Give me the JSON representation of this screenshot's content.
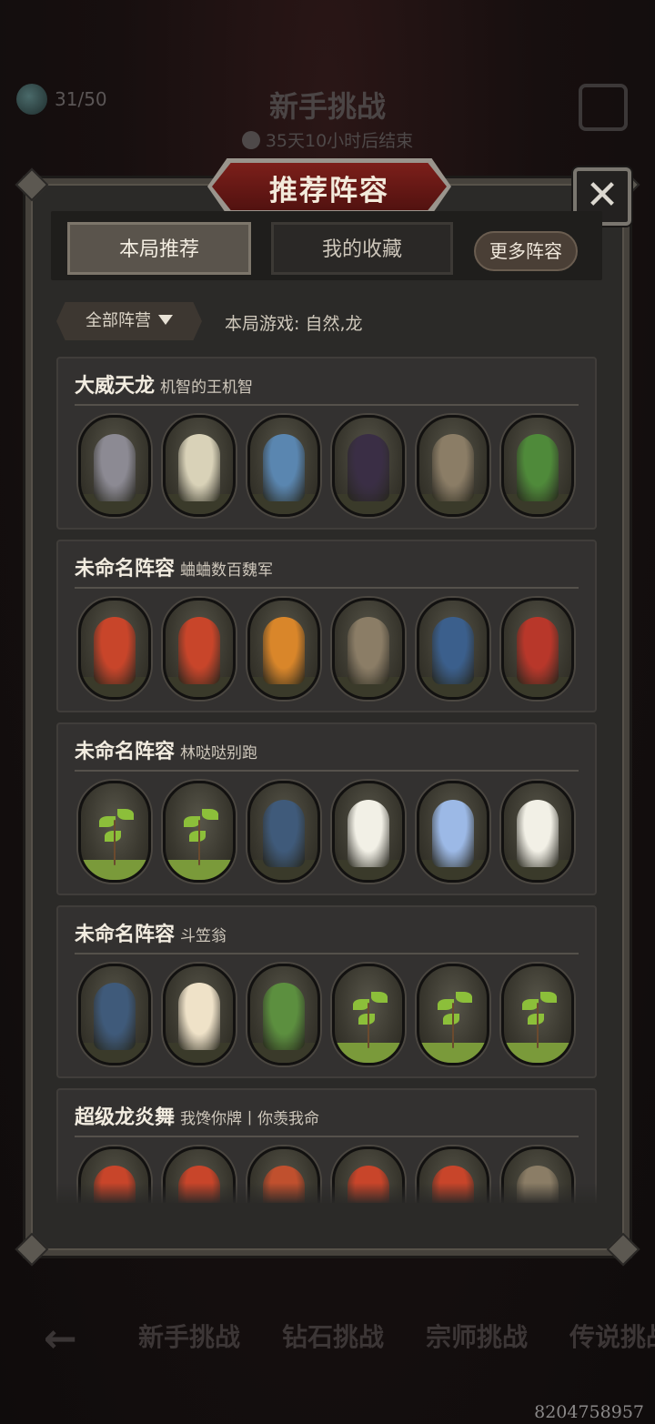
{
  "background": {
    "counter": "31/50",
    "title": "新手挑战",
    "timer": "35天10小时后结束",
    "bottom_tabs": [
      "新手挑战",
      "钻石挑战",
      "宗师挑战",
      "传说挑战"
    ],
    "watermark": "8204758957"
  },
  "modal": {
    "title": "推荐阵容",
    "close_label": "✕",
    "tabs": [
      {
        "label": "本局推荐"
      },
      {
        "label": "我的收藏"
      }
    ],
    "more_button": "更多阵容",
    "filter": {
      "label": "全部阵营"
    },
    "game_info": "本局游戏: 自然,龙"
  },
  "lineups": [
    {
      "name": "大威天龙",
      "author": "机智的王机智",
      "heroes": [
        "ghost-dragon",
        "white-serpent-dragon",
        "blue-baby-dragon",
        "black-dragon",
        "gargoyle-bat",
        "green-horned-dragon"
      ]
    },
    {
      "name": "未命名阵容",
      "author": "蛐蛐数百魏军",
      "heroes": [
        "fire-dragon",
        "fire-dragon",
        "flame-wyrm",
        "gargoyle-bat",
        "blue-shadow-dragon",
        "red-dragon"
      ]
    },
    {
      "name": "未命名阵容",
      "author": "林哒哒别跑",
      "heroes": [
        "sapling",
        "sapling",
        "dark-elf",
        "singing-flower",
        "ice-maiden",
        "singing-flower"
      ]
    },
    {
      "name": "未命名阵容",
      "author": "斗笠翁",
      "heroes": [
        "dark-elf",
        "flower-fairy",
        "cactus",
        "sapling",
        "sapling",
        "sapling"
      ]
    },
    {
      "name": "超级龙炎舞",
      "author": "我馋你牌丨你羡我命",
      "heroes": [
        "fire-dragon",
        "fire-dragon",
        "fire-mage",
        "fire-dragon",
        "fire-dragon",
        "gargoyle-bat"
      ]
    }
  ],
  "hero_colors": {
    "ghost-dragon": "#8c8a93",
    "white-serpent-dragon": "#d9d2b8",
    "blue-baby-dragon": "#5a86b0",
    "black-dragon": "#3a2e45",
    "gargoyle-bat": "#8b7d66",
    "green-horned-dragon": "#4f8a3a",
    "fire-dragon": "#c8452a",
    "flame-wyrm": "#d9862a",
    "blue-shadow-dragon": "#3b5f8c",
    "red-dragon": "#b8372a",
    "dark-elf": "#3f5a7a",
    "singing-flower": "#f2f0e6",
    "ice-maiden": "#9cb9e6",
    "flower-fairy": "#efe2c8",
    "cactus": "#5c8f3f",
    "fire-mage": "#c0502e",
    "sapling": "#6b4a2e"
  },
  "accent": {
    "title_red": "#7c1f1a",
    "panel": "#2b2a28"
  }
}
